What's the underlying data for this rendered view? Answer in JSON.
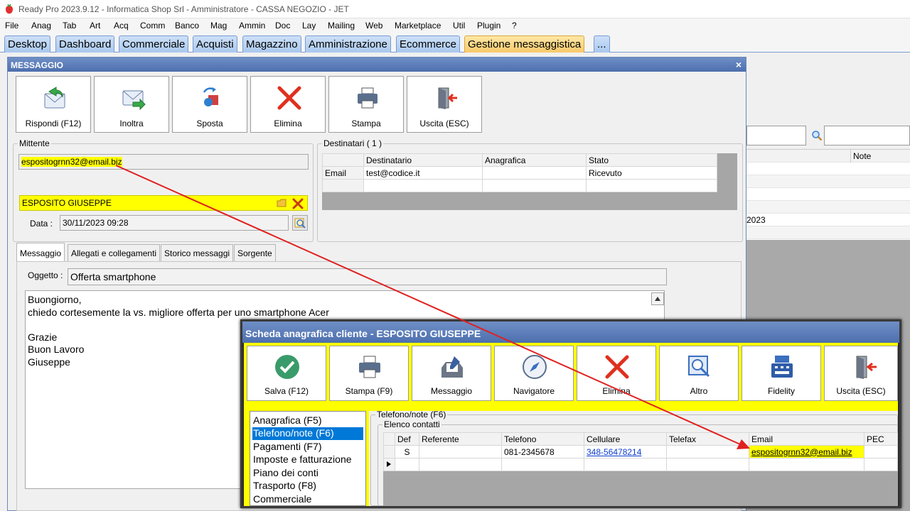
{
  "app": {
    "title": "Ready Pro 2023.9.12 - Informatica Shop Srl - Amministratore - CASSA NEGOZIO - JET"
  },
  "menu": [
    "File",
    "Anag",
    "Tab",
    "Art",
    "Acq",
    "Comm",
    "Banco",
    "Mag",
    "Ammin",
    "Doc",
    "Lay",
    "Mailing",
    "Web",
    "Marketplace",
    "Util",
    "Plugin",
    "?"
  ],
  "tabs": [
    "Desktop",
    "Dashboard",
    "Commerciale",
    "Acquisti",
    "Magazzino",
    "Amministrazione",
    "Ecommerce",
    "Gestione messaggistica",
    "..."
  ],
  "active_tab": "Gestione messaggistica",
  "background_window": {
    "column_note": "Note",
    "partial_cell": "2023"
  },
  "message_dialog": {
    "title": "MESSAGGIO",
    "close": "×",
    "toolbar": {
      "reply": "Rispondi (F12)",
      "forward": "Inoltra",
      "move": "Sposta",
      "delete": "Elimina",
      "print": "Stampa",
      "exit": "Uscita (ESC)"
    },
    "sender": {
      "legend": "Mittente",
      "email": "espositogrnn32@email.biz",
      "name": "ESPOSITO GIUSEPPE",
      "date_label": "Data :",
      "date_value": "30/11/2023 09:28"
    },
    "recipients": {
      "legend": "Destinatari ( 1 )",
      "headers": [
        "Destinatario",
        "Anagrafica",
        "Stato"
      ],
      "rows": [
        {
          "type": "Email",
          "recipient": "test@codice.it",
          "anagrafica": "",
          "status": "Ricevuto"
        }
      ]
    },
    "subtabs": [
      "Messaggio",
      "Allegati e collegamenti",
      "Storico messaggi",
      "Sorgente"
    ],
    "subject_label": "Oggetto :",
    "subject": "Offerta smartphone",
    "body_lines": [
      "Buongiorno,",
      "chiedo cortesemente la vs. migliore offerta per uno smartphone Acer",
      "",
      "Grazie",
      "Buon Lavoro",
      "Giuseppe"
    ]
  },
  "client_card": {
    "title": "Scheda anagrafica cliente - ESPOSITO GIUSEPPE",
    "toolbar": {
      "save": "Salva (F12)",
      "print": "Stampa (F9)",
      "message": "Messaggio",
      "navigator": "Navigatore",
      "delete": "Elimina",
      "other": "Altro",
      "fidelity": "Fidelity",
      "exit": "Uscita (ESC)"
    },
    "nav": [
      "Anagrafica (F5)",
      "Telefono/note (F6)",
      "Pagamenti (F7)",
      "Imposte e fatturazione",
      "Piano dei conti",
      "Trasporto (F8)",
      "Commerciale"
    ],
    "nav_selected": "Telefono/note (F6)",
    "panel_title": "Telefono/note (F6)",
    "contacts_legend": "Elenco contatti",
    "contacts_headers": [
      "Def",
      "Referente",
      "Telefono",
      "Cellulare",
      "Telefax",
      "Email",
      "PEC"
    ],
    "contacts_rows": [
      {
        "def": "S",
        "referente": "",
        "telefono": "081-2345678",
        "cellulare": "348-56478214",
        "telefax": "",
        "email": "espositogrnn32@email.biz",
        "pec": ""
      }
    ]
  },
  "colors": {
    "highlight": "#ffff00",
    "arrow": "#e02020",
    "title_bar": "#5577b5",
    "active_tab": "#f7c96a"
  }
}
